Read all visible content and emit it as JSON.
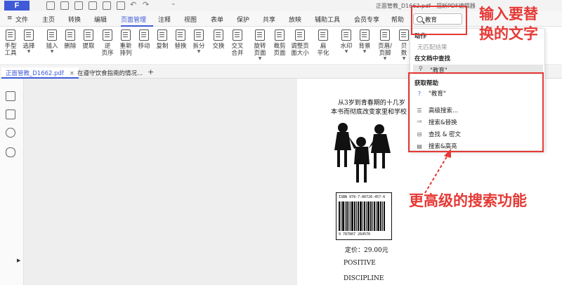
{
  "window": {
    "title": "正面管教_D1662.pdf - 福昕PDF编辑器",
    "logo": "F"
  },
  "menu": {
    "file": "文件",
    "items": [
      "主页",
      "转换",
      "编辑",
      "页面管理",
      "注释",
      "视图",
      "表单",
      "保护",
      "共享",
      "放映",
      "辅助工具",
      "会员专享",
      "帮助"
    ],
    "active": "页面管理"
  },
  "ribbon": {
    "tools": [
      {
        "label": "手型\n工具",
        "dropdown": false
      },
      {
        "label": "选择",
        "dropdown": true
      },
      {
        "label": "插入",
        "dropdown": true
      },
      {
        "label": "删除",
        "dropdown": false
      },
      {
        "label": "提取",
        "dropdown": false
      },
      {
        "label": "逆\n页序",
        "dropdown": false
      },
      {
        "label": "重新\n排列",
        "dropdown": false
      },
      {
        "label": "移动",
        "dropdown": false
      },
      {
        "label": "复制",
        "dropdown": false
      },
      {
        "label": "替换",
        "dropdown": false
      },
      {
        "label": "拆分",
        "dropdown": true
      },
      {
        "label": "交换",
        "dropdown": false
      },
      {
        "label": "交叉\n合并",
        "dropdown": false
      },
      {
        "label": "旋转\n页面",
        "dropdown": true
      },
      {
        "label": "裁剪\n页面",
        "dropdown": false
      },
      {
        "label": "调整页\n面大小",
        "dropdown": false
      },
      {
        "label": "扁\n平化",
        "dropdown": false
      },
      {
        "label": "水印",
        "dropdown": true
      },
      {
        "label": "背景",
        "dropdown": true
      },
      {
        "label": "页眉/\n页脚",
        "dropdown": true
      },
      {
        "label": "贝\n数",
        "dropdown": true
      }
    ]
  },
  "tabs": [
    {
      "label": "正面管教_D1662.pdf",
      "active": true
    },
    {
      "label": "在遵守饮食指南的情况...",
      "active": false
    }
  ],
  "tab_add": "+",
  "search": {
    "value": "教育"
  },
  "dropdown": {
    "action_header": "动作",
    "no_match": "无匹配结果",
    "find_header": "在文档中查找",
    "query_item": "\"教育\"",
    "help_header": "获取帮助",
    "help_item": "\"教育\"",
    "items": [
      "高级搜索...",
      "搜索&替换",
      "查找 & 密文",
      "搜索&高亮"
    ]
  },
  "page": {
    "line1": "从3岁到青春期的十几岁",
    "line2": "本书而彻底改变家里和学校",
    "barcode_top": "ISBN 978-7-80726-457-6",
    "barcode_num": "9 787807 264576",
    "price": "定价：29.00元",
    "positive": "POSITIVE",
    "discipline": "DISCIPLINE"
  },
  "annotations": {
    "top_note": "输入要替\n换的文字",
    "bottom_note": "更高级的搜索功能",
    "color": "#e53935"
  },
  "colors": {
    "accent": "#3f5bd8",
    "annotation": "#e53935"
  }
}
